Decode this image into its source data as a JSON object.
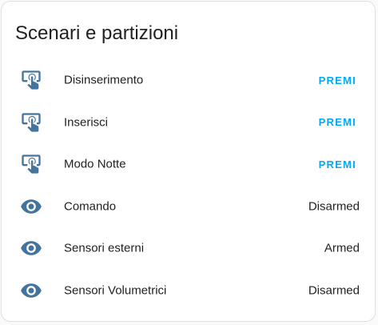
{
  "card": {
    "title": "Scenari e partizioni"
  },
  "rows": [
    {
      "icon": "gesture-tap-button-icon",
      "name": "Disinserimento",
      "action_label": "PREMI"
    },
    {
      "icon": "gesture-tap-button-icon",
      "name": "Inserisci",
      "action_label": "PREMI"
    },
    {
      "icon": "gesture-tap-button-icon",
      "name": "Modo Notte",
      "action_label": "PREMI"
    },
    {
      "icon": "eye-icon",
      "name": "Comando",
      "state": "Disarmed"
    },
    {
      "icon": "eye-icon",
      "name": "Sensori esterni",
      "state": "Armed"
    },
    {
      "icon": "eye-icon",
      "name": "Sensori Volumetrici",
      "state": "Disarmed"
    }
  ],
  "colors": {
    "icon": "#44739e",
    "accent": "#03a9f4",
    "text": "#212121"
  }
}
